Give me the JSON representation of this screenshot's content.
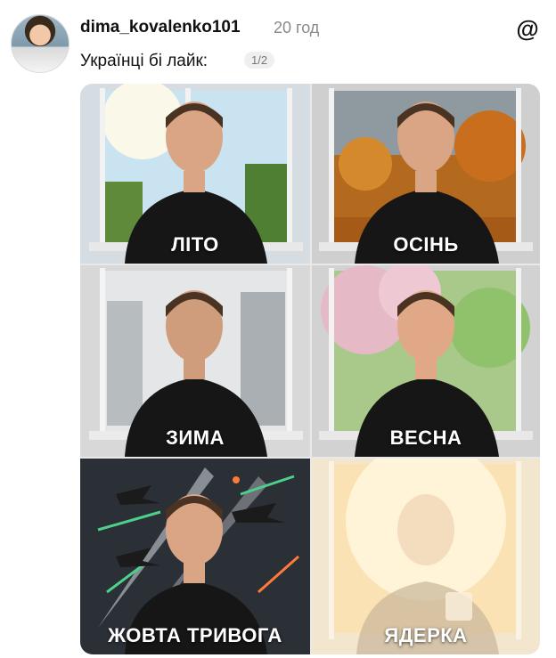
{
  "post": {
    "username": "dima_kovalenko101",
    "time": "20 год",
    "caption": "Українці бі лайк:",
    "image_counter": "1/2"
  },
  "icons": {
    "app_logo": "threads-logo-icon"
  },
  "tiles": [
    {
      "label": "ЛІТО"
    },
    {
      "label": "ОСІНЬ"
    },
    {
      "label": "ЗИМА"
    },
    {
      "label": "ВЕСНА"
    },
    {
      "label": "ЖОВТА ТРИВОГА"
    },
    {
      "label": "ЯДЕРКА"
    }
  ]
}
